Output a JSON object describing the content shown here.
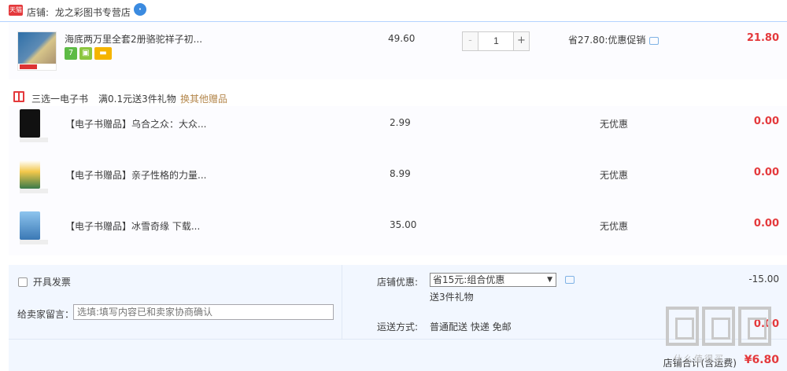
{
  "shop": {
    "badge": "天猫",
    "label": "店铺:",
    "name": "龙之彩图书专营店",
    "ww_icon": "wangwang-chat-icon"
  },
  "item": {
    "title": "海底两万里全套2册骆驼祥子初...",
    "price": "49.60",
    "qty_minus": "-",
    "quantity": "1",
    "qty_plus": "+",
    "promo": "省27.80:优惠促销",
    "subtotal": "21.80",
    "service_icons": [
      "7-day-return-icon",
      "delivery-box-icon",
      "credit-card-icon"
    ],
    "thumb_text": "名师推荐 学校指定版"
  },
  "gift_section": {
    "label": "三选一电子书",
    "condition": "满0.1元送3件礼物",
    "change_link": "换其他赠品",
    "gifts": [
      {
        "name": "【电子书赠品】乌合之众：大众...",
        "price": "2.99",
        "discount": "无优惠",
        "subtotal": "0.00"
      },
      {
        "name": "【电子书赠品】亲子性格的力量...",
        "price": "8.99",
        "discount": "无优惠",
        "subtotal": "0.00"
      },
      {
        "name": "【电子书赠品】冰雪奇缘 下载...",
        "price": "35.00",
        "discount": "无优惠",
        "subtotal": "0.00"
      }
    ]
  },
  "footer": {
    "invoice_label": "开具发票",
    "message_label": "给卖家留言：",
    "message_placeholder": "选填:填写内容已和卖家协商确认",
    "shop_discount_label": "店铺优惠:",
    "shop_discount_value": "省15元:组合优惠",
    "gift_note": "送3件礼物",
    "shop_discount_amount": "-15.00",
    "shipping_label": "运送方式:",
    "shipping_value": "普通配送 快递 免邮",
    "shipping_amount": "0.00",
    "total_label": "店铺合计(含运费)",
    "total_amount": "¥6.80"
  },
  "watermark": {
    "text": "什么值得买"
  }
}
